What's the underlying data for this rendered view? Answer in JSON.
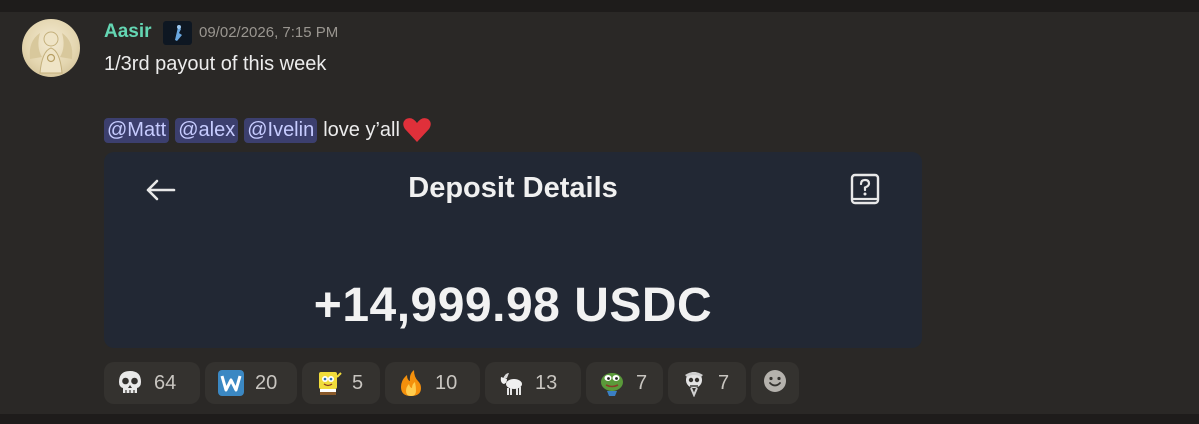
{
  "message": {
    "author": "Aasir",
    "timestamp": "09/02/2026, 7:15 PM",
    "line1": "1/3rd payout of this week",
    "mentions": [
      "@Matt",
      "@alex",
      "@Ivelin"
    ],
    "trailing_text": "love y’all"
  },
  "embed": {
    "title": "Deposit Details",
    "amount": "+14,999.98 USDC"
  },
  "reactions": [
    {
      "icon": "skull-emoji",
      "count": "64"
    },
    {
      "icon": "w-letter-emoji",
      "count": "20"
    },
    {
      "icon": "spongebob-emoji",
      "count": "5"
    },
    {
      "icon": "fire-emoji",
      "count": "10"
    },
    {
      "icon": "goat-emoji",
      "count": "13"
    },
    {
      "icon": "pepe-emoji",
      "count": "7"
    },
    {
      "icon": "skeleton-emoji",
      "count": "7"
    }
  ],
  "colors": {
    "background": "#2a2826",
    "username": "#64d6b3",
    "mention_bg": "#3c3f6e",
    "embed_bg": "#222834",
    "reaction_bg": "#34322f"
  }
}
